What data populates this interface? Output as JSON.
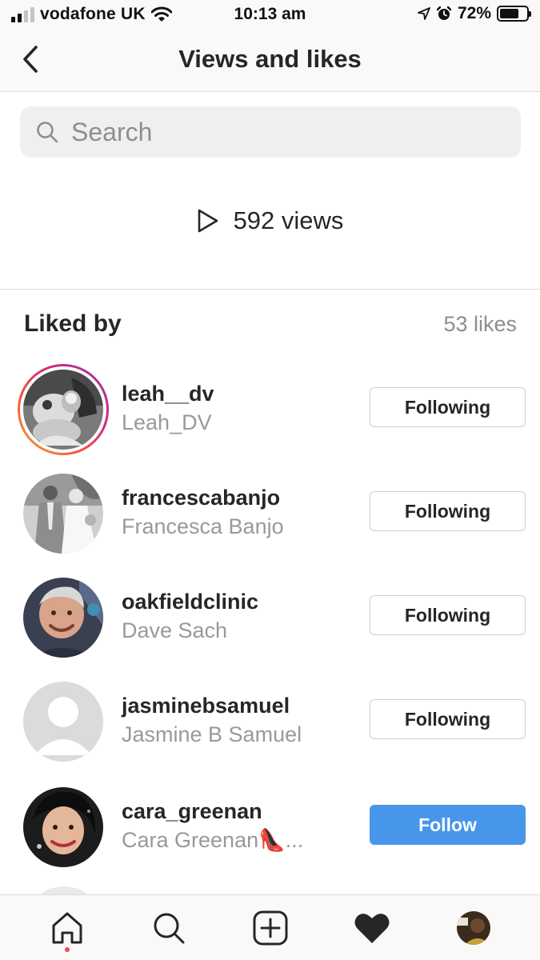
{
  "status_bar": {
    "carrier": "vodafone UK",
    "time": "10:13 am",
    "battery": "72%",
    "battery_level": 0.72
  },
  "header": {
    "title": "Views and likes"
  },
  "search": {
    "placeholder": "Search"
  },
  "views": {
    "text": "592 views"
  },
  "liked_by": {
    "title": "Liked by",
    "count": "53 likes",
    "users": [
      {
        "username": "leah__dv",
        "full_name": "Leah_DV",
        "button": "Following",
        "has_story_ring": true
      },
      {
        "username": "francescabanjo",
        "full_name": "Francesca Banjo",
        "button": "Following",
        "has_story_ring": false
      },
      {
        "username": "oakfieldclinic",
        "full_name": "Dave Sach",
        "button": "Following",
        "has_story_ring": false
      },
      {
        "username": "jasminebsamuel",
        "full_name": "Jasmine B Samuel",
        "button": "Following",
        "has_story_ring": false
      },
      {
        "username": "cara_greenan",
        "full_name": "Cara Greenan👠...",
        "button": "Follow",
        "has_story_ring": false
      }
    ]
  },
  "colors": {
    "follow_blue": "#4796eb",
    "notification_dot": "#ed4956",
    "secondary_text": "#8e8e8e"
  },
  "bottom_nav": {
    "items": [
      "home-icon",
      "search-icon",
      "new-post-icon",
      "activity-heart-icon",
      "profile-avatar"
    ]
  }
}
